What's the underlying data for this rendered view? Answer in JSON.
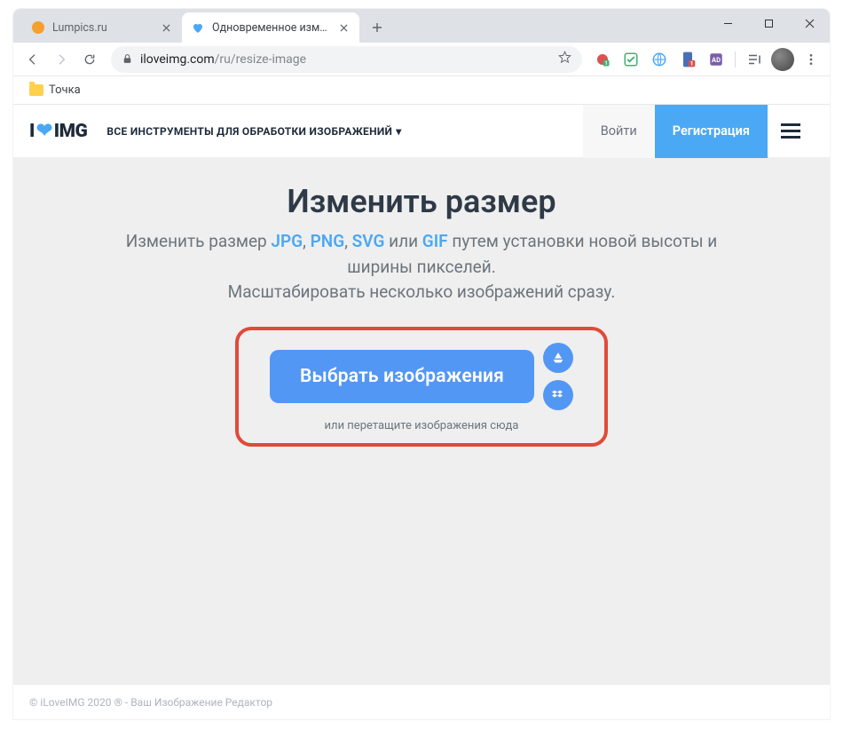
{
  "window": {
    "tabs": [
      {
        "title": "Lumpics.ru",
        "active": false
      },
      {
        "title": "Одновременное изменение ра",
        "active": true
      }
    ],
    "url_domain": "iloveimg.com",
    "url_path": "/ru/resize-image"
  },
  "bookmarks": {
    "item1": "Точка"
  },
  "header": {
    "logo_left": "I",
    "logo_right": "IMG",
    "tools_menu": "ВСЕ ИНСТРУМЕНТЫ ДЛЯ ОБРАБОТКИ ИЗОБРАЖЕНИЙ",
    "login": "Войти",
    "signup": "Регистрация"
  },
  "content": {
    "title": "Изменить размер",
    "sub_p1": "Изменить размер ",
    "fmt_jpg": "JPG",
    "sep": ", ",
    "fmt_png": "PNG",
    "fmt_svg": "SVG",
    "or": " или ",
    "fmt_gif": "GIF",
    "sub_p2": " путем установки новой высоты и ширины пикселей.",
    "sub_line2": "Масштабировать несколько изображений сразу.",
    "upload_label": "Выбрать изображения",
    "drag_hint": "или перетащите изображения сюда"
  },
  "footer": {
    "text": "© iLoveIMG 2020 ® - Ваш Изображение Редактор"
  }
}
